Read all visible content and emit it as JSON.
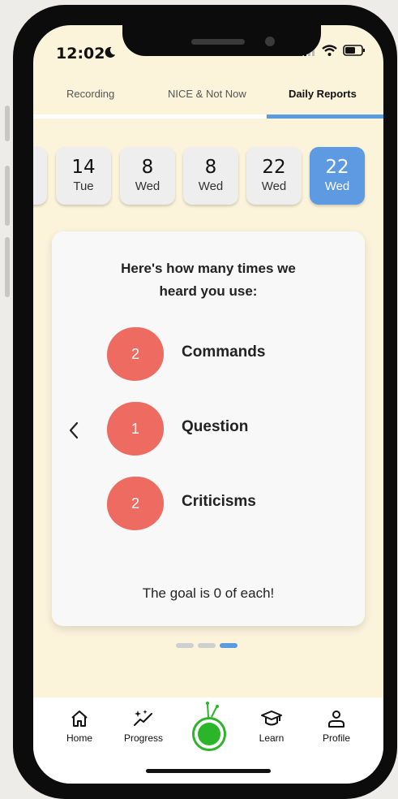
{
  "status_bar": {
    "time": "12:02"
  },
  "tabs": [
    {
      "label": "Recording"
    },
    {
      "label": "NICE & Not Now"
    },
    {
      "label": "Daily Reports",
      "active": true
    }
  ],
  "dates": [
    {
      "day": "14",
      "weekday": "Tue"
    },
    {
      "day": "8",
      "weekday": "Wed"
    },
    {
      "day": "8",
      "weekday": "Wed"
    },
    {
      "day": "22",
      "weekday": "Wed"
    },
    {
      "day": "22",
      "weekday": "Wed",
      "selected": true
    }
  ],
  "report": {
    "title_line1": "Here's how many times we",
    "title_line2": "heard you use:",
    "metrics": [
      {
        "count": "2",
        "label": "Commands"
      },
      {
        "count": "1",
        "label": "Question"
      },
      {
        "count": "2",
        "label": "Criticisms"
      }
    ],
    "goal": "The goal is 0 of each!"
  },
  "pager": {
    "pages": 3,
    "active": 3
  },
  "bottom_nav": [
    {
      "label": "Home",
      "icon": "home-icon"
    },
    {
      "label": "Progress",
      "icon": "sparkle-chart-icon"
    },
    {
      "label": "",
      "icon": "record-icon"
    },
    {
      "label": "Learn",
      "icon": "graduation-cap-icon"
    },
    {
      "label": "Profile",
      "icon": "person-icon"
    }
  ],
  "colors": {
    "background": "#fbf3da",
    "accent_blue": "#5d9ae2",
    "metric_red": "#ed6b60",
    "record_green": "#2bb529"
  }
}
